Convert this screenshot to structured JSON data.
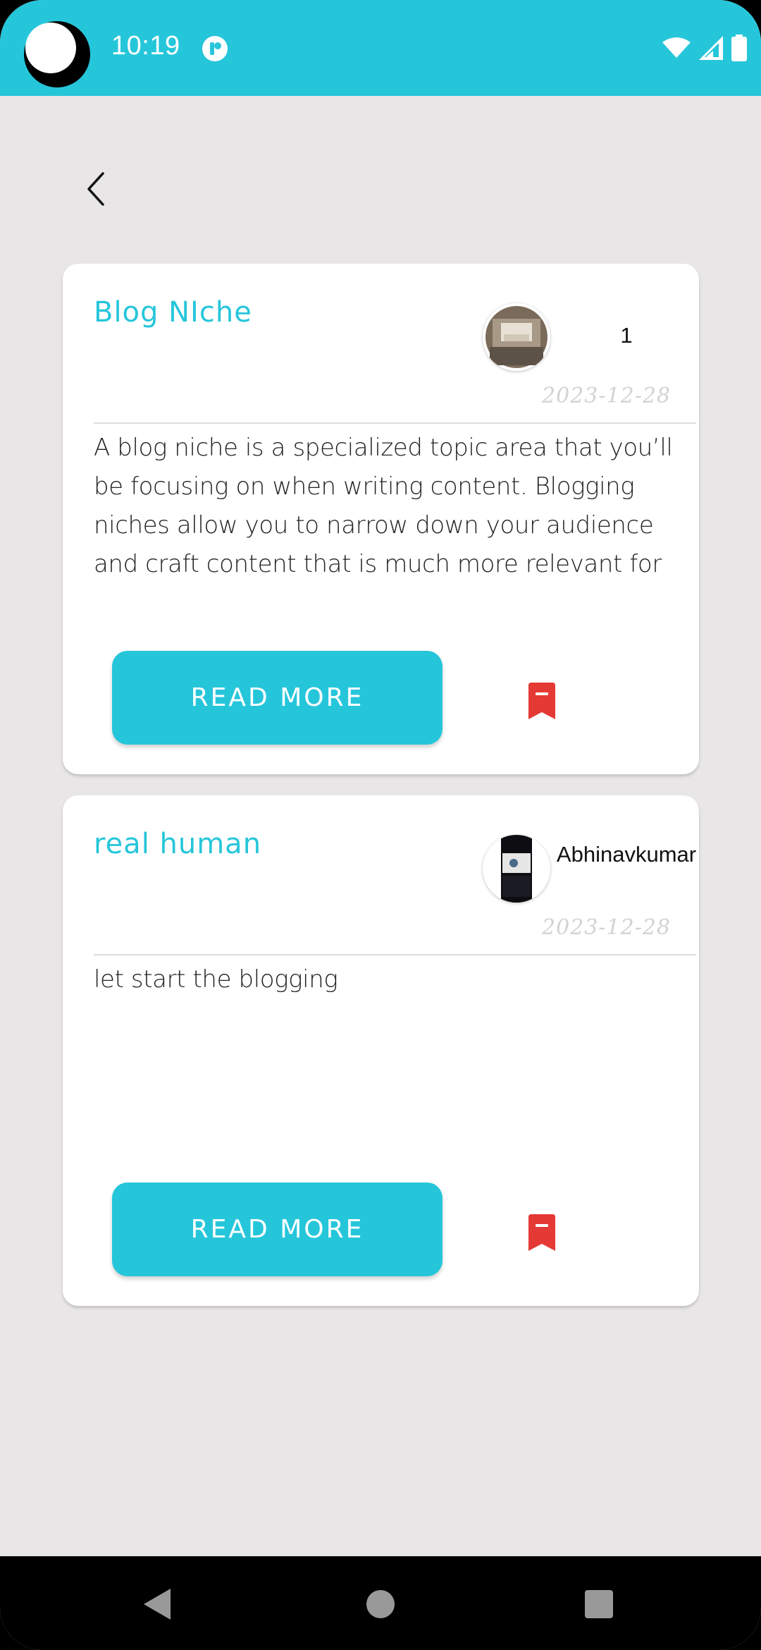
{
  "status_bar": {
    "time": "10:19",
    "app_icon": "notification-app-icon",
    "icons": [
      "wifi-icon",
      "cellular-signal-icon",
      "battery-icon"
    ],
    "color": "#26c6da"
  },
  "header": {
    "back_icon": "chevron-left-icon"
  },
  "posts": [
    {
      "title": "Blog NIche",
      "author": "1",
      "date": "2023-12-28",
      "body": "A blog niche is a specialized topic area that you’ll be focusing on when writing content. Blogging niches allow you to narrow down your audience and craft content that is much more relevant for them.As",
      "read_more_label": "READ MORE",
      "bookmark_icon": "bookmark-remove-icon"
    },
    {
      "title": "real human",
      "author": "Abhinavkumar",
      "date": "2023-12-28",
      "body": "let start the blogging",
      "read_more_label": "READ MORE",
      "bookmark_icon": "bookmark-remove-icon"
    }
  ],
  "nav_bar": {
    "icons": [
      "nav-back-icon",
      "nav-home-icon",
      "nav-recents-icon"
    ]
  },
  "colors": {
    "accent": "#26c6da",
    "bookmark": "#e53935",
    "background": "#e8e6e7"
  }
}
